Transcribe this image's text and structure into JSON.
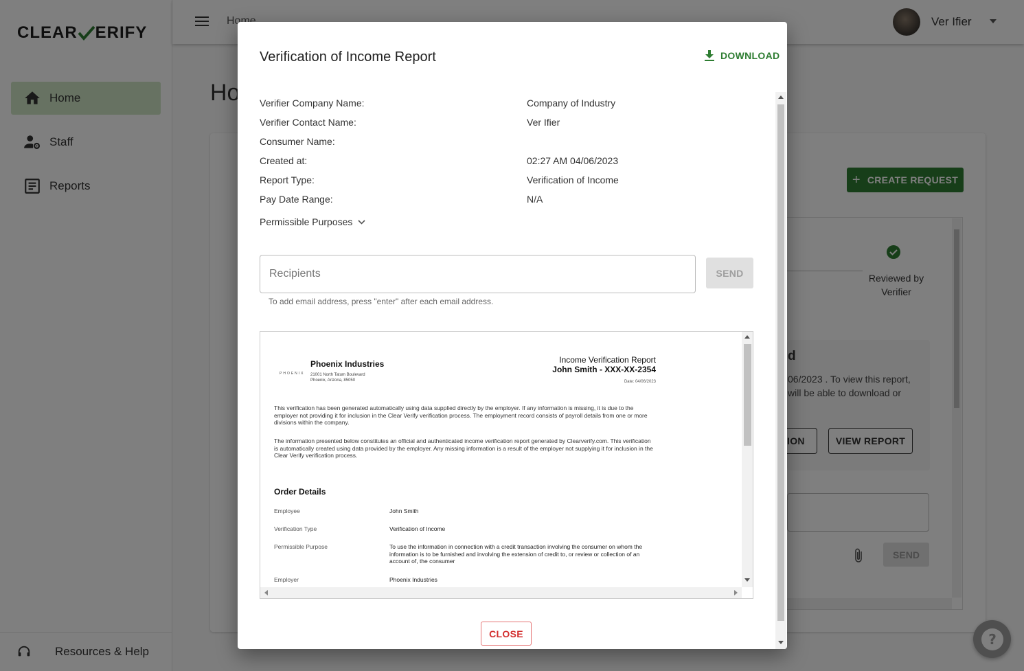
{
  "app": {
    "logo_left": "CLEAR",
    "logo_right": "ERIFY",
    "breadcrumb": "Home",
    "page_title": "Ho",
    "user_name": "Ver Ifier",
    "nav": [
      {
        "label": "Home",
        "icon": "home-icon"
      },
      {
        "label": "Staff",
        "icon": "staff-settings-icon"
      },
      {
        "label": "Reports",
        "icon": "reports-icon"
      }
    ],
    "footer_link": "Resources & Help",
    "create_request": "CREATE REQUEST",
    "reviewed_label": "Reviewed by Verifier",
    "status_title": "d",
    "status_text": "06/2023 . To view this report, will be able to download or",
    "action_partial": "TION",
    "view_report": "VIEW REPORT",
    "bg_send": "SEND",
    "accent_color": "#2e7d32"
  },
  "modal": {
    "title": "Verification of Income Report",
    "download_label": "DOWNLOAD",
    "fields": [
      {
        "key": "Verifier Company Name:",
        "value": "Company of Industry"
      },
      {
        "key": "Verifier Contact Name:",
        "value": "Ver Ifier"
      },
      {
        "key": "Consumer Name:",
        "value": ""
      },
      {
        "key": "Created at:",
        "value": "02:27 AM 04/06/2023"
      },
      {
        "key": "Report Type:",
        "value": "Verification of Income"
      },
      {
        "key": "Pay Date Range:",
        "value": "N/A"
      }
    ],
    "permissible_purposes": "Permissible Purposes",
    "recipients_placeholder": "Recipients",
    "send_label": "SEND",
    "hint": "To add email address, press \"enter\" after each email address.",
    "close_label": "CLOSE"
  },
  "report": {
    "logo_text": "PHOENIX",
    "company": "Phoenix Industries",
    "address_line1": "21001 North Tatum Boulevard",
    "address_line2": "Phoenix, Arizona, 85050",
    "report_title": "Income Verification Report",
    "report_subject": "John Smith - XXX-XX-2354",
    "report_date": "Date: 04/06/2023",
    "para1": "This verification has been generated automatically using data supplied directly by the employer. If any information is missing, it is due to the employer not providing it for inclusion in the Clear Verify verification process. The employment record consists of payroll details from one or more divisions within the company.",
    "para2": "The information presented below constitutes an official and authenticated income verification report generated by Clearverify.com. This verification is automatically created using data provided by the employer. Any missing information is a result of the employer not supplying it for inclusion in the Clear Verify verification process.",
    "order_heading": "Order Details",
    "order_rows": [
      {
        "key": "Employee",
        "value": "John Smith"
      },
      {
        "key": "Verification Type",
        "value": "Verification of Income"
      },
      {
        "key": "Permissible Purpose",
        "value": "To use the information in connection with a credit transaction involving the consumer on whom the information is to be furnished and involving the extension of credit to, or review or collection of an account of, the consumer"
      },
      {
        "key": "Employer",
        "value": "Phoenix Industries"
      }
    ]
  }
}
